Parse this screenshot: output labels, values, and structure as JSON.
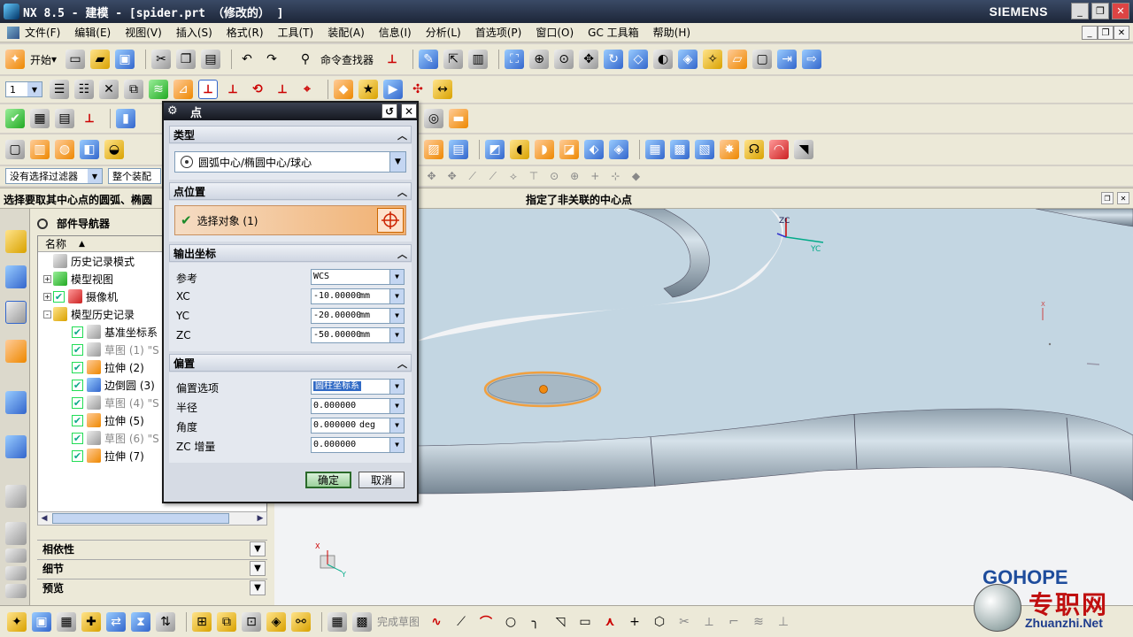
{
  "window": {
    "title": "NX 8.5 - 建模 - [spider.prt （修改的） ]",
    "brand": "SIEMENS",
    "controls": [
      "_",
      "❐",
      "✕"
    ]
  },
  "menubar": {
    "items": [
      "文件(F)",
      "编辑(E)",
      "视图(V)",
      "插入(S)",
      "格式(R)",
      "工具(T)",
      "装配(A)",
      "信息(I)",
      "分析(L)",
      "首选项(P)",
      "窗口(O)",
      "GC 工具箱",
      "帮助(H)"
    ]
  },
  "toolbar1": {
    "start_label": "开始",
    "command_finder_label": "命令查找器"
  },
  "toolbar2": {
    "layer_value": "1"
  },
  "selection_bar": {
    "filter_value": "没有选择过滤器",
    "scope_value": "整个装配"
  },
  "status": {
    "prompt": "选择要取其中心点的圆弧、椭圆",
    "center_message": "指定了非关联的中心点"
  },
  "navigator": {
    "title": "部件导航器",
    "column_name": "名称",
    "tree": [
      {
        "label": "历史记录模式",
        "level": 0,
        "expander": "",
        "check": false,
        "dim": false
      },
      {
        "label": "模型视图",
        "level": 0,
        "expander": "+",
        "check": false,
        "dim": false
      },
      {
        "label": "摄像机",
        "level": 0,
        "expander": "+",
        "check": true,
        "dim": false
      },
      {
        "label": "模型历史记录",
        "level": 0,
        "expander": "-",
        "check": false,
        "dim": false
      },
      {
        "label": "基准坐标系",
        "level": 1,
        "expander": "",
        "check": true,
        "dim": false
      },
      {
        "label": "草图 (1) \"S",
        "level": 1,
        "expander": "",
        "check": true,
        "dim": true
      },
      {
        "label": "拉伸 (2)",
        "level": 1,
        "expander": "",
        "check": true,
        "dim": false
      },
      {
        "label": "边倒圆 (3)",
        "level": 1,
        "expander": "",
        "check": true,
        "dim": false
      },
      {
        "label": "草图 (4) \"S",
        "level": 1,
        "expander": "",
        "check": true,
        "dim": true
      },
      {
        "label": "拉伸 (5)",
        "level": 1,
        "expander": "",
        "check": true,
        "dim": false
      },
      {
        "label": "草图 (6) \"S",
        "level": 1,
        "expander": "",
        "check": true,
        "dim": true
      },
      {
        "label": "拉伸 (7)",
        "level": 1,
        "expander": "",
        "check": true,
        "dim": false
      }
    ],
    "sections": [
      "相依性",
      "细节",
      "预览"
    ]
  },
  "point_dialog": {
    "title": "点",
    "sections": {
      "type": "类型",
      "point_location": "点位置",
      "output_coords": "输出坐标",
      "offset": "偏置"
    },
    "type_value": "圆弧中心/椭圆中心/球心",
    "select_object_label": "选择对象 (1)",
    "output": {
      "reference_label": "参考",
      "reference_value": "WCS",
      "xc_label": "XC",
      "xc_value": "-10.00000",
      "yc_label": "YC",
      "yc_value": "-20.00000",
      "zc_label": "ZC",
      "zc_value": "-50.00000",
      "unit": "mm"
    },
    "offset": {
      "option_label": "偏置选项",
      "option_value": "圆柱坐标系",
      "radius_label": "半径",
      "radius_value": "0.000000",
      "radius_unit": "mm",
      "angle_label": "角度",
      "angle_value": "0.000000",
      "angle_unit": "deg",
      "zc_inc_label": "ZC 增量",
      "zc_inc_value": "0.000000",
      "zc_inc_unit": "mm"
    },
    "ok_label": "确定",
    "cancel_label": "取消"
  },
  "graphics": {
    "triad_labels": {
      "zc": "ZC",
      "yc": "YC",
      "x": "X",
      "y": "Y"
    },
    "part_color": "#c3d6e2",
    "highlight_color": "#f0a040"
  },
  "bottom_toolbar": {
    "finish_sketch_label": "完成草图"
  },
  "watermark": {
    "brand": "GOHOPE",
    "cn": "专职网",
    "site": "Zhuanzhi.Net"
  }
}
